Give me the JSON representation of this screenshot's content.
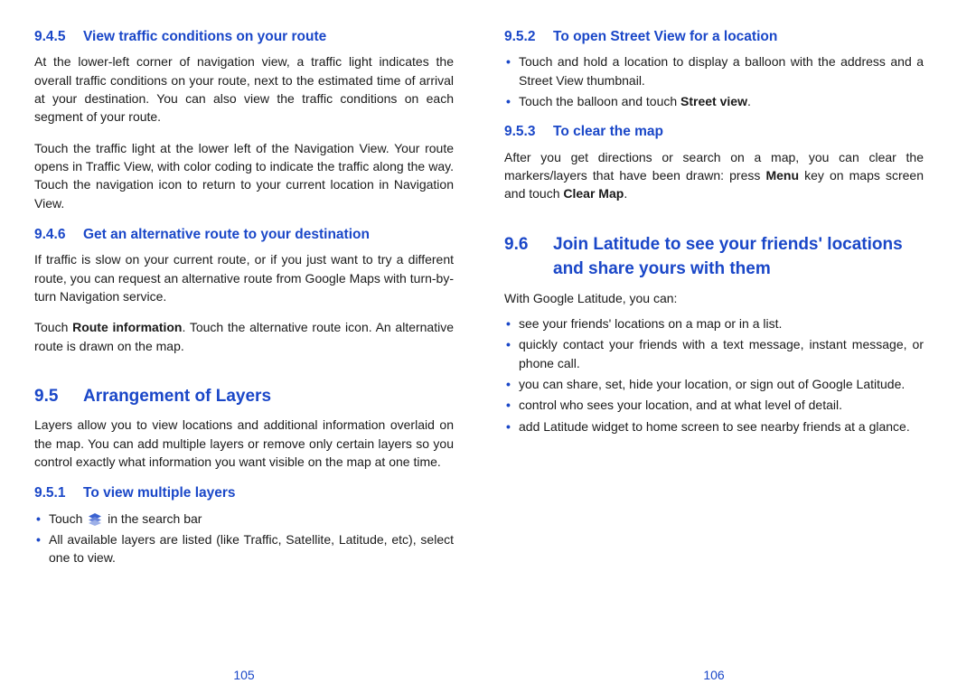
{
  "left": {
    "s945": {
      "num": "9.4.5",
      "title": "View traffic conditions on your route",
      "p1": "At the lower-left corner of navigation view, a traffic light indicates the overall traffic conditions on your route, next to the estimated time of arrival at your destination. You can also view the traffic conditions on each segment of your route.",
      "p2": "Touch the traffic light at the lower left of the Navigation View. Your route opens in Traffic View, with color coding to indicate the traffic along the way. Touch the navigation icon to return to your current location in Navigation View."
    },
    "s946": {
      "num": "9.4.6",
      "title": "Get an alternative route to your destination",
      "p1": "If traffic is slow on your current route, or if you just want to try a different route, you can request an alternative route from Google Maps with turn-by-turn Navigation service.",
      "p2a": "Touch ",
      "p2bold": "Route information",
      "p2b": ". Touch the alternative route icon. An alternative route is drawn on the map."
    },
    "s95": {
      "num": "9.5",
      "title": "Arrangement of Layers",
      "p1": "Layers allow you to view locations and additional information overlaid on the map. You can add multiple layers or remove only certain layers so you control exactly what information you want visible on the map at one time."
    },
    "s951": {
      "num": "9.5.1",
      "title": "To view multiple layers",
      "li1a": "Touch ",
      "li1b": " in the search bar",
      "li2": "All available layers are listed (like Traffic, Satellite, Latitude, etc), select one to view."
    },
    "pageNum": "105"
  },
  "right": {
    "s952": {
      "num": "9.5.2",
      "title": "To open Street View for a location",
      "li1": "Touch and hold a location to display a balloon with the address and a Street View thumbnail.",
      "li2a": "Touch the balloon and touch ",
      "li2bold": "Street view",
      "li2b": "."
    },
    "s953": {
      "num": "9.5.3",
      "title": "To clear the map",
      "p1a": "After you get directions or search on a map, you can clear the markers/layers that have been drawn: press ",
      "p1bold1": "Menu",
      "p1b": " key on maps screen and touch ",
      "p1bold2": "Clear Map",
      "p1c": "."
    },
    "s96": {
      "num": "9.6",
      "title": "Join Latitude to see your friends' locations and share yours with them",
      "p1": "With Google Latitude, you can:",
      "li1": "see your friends' locations on a map or in a list.",
      "li2": "quickly contact your friends with a text message, instant message, or phone call.",
      "li3": "you can share, set, hide your location, or sign out of Google Latitude.",
      "li4": "control who sees your location, and at what level of detail.",
      "li5": "add Latitude widget to home screen to see nearby friends at a glance."
    },
    "pageNum": "106"
  }
}
